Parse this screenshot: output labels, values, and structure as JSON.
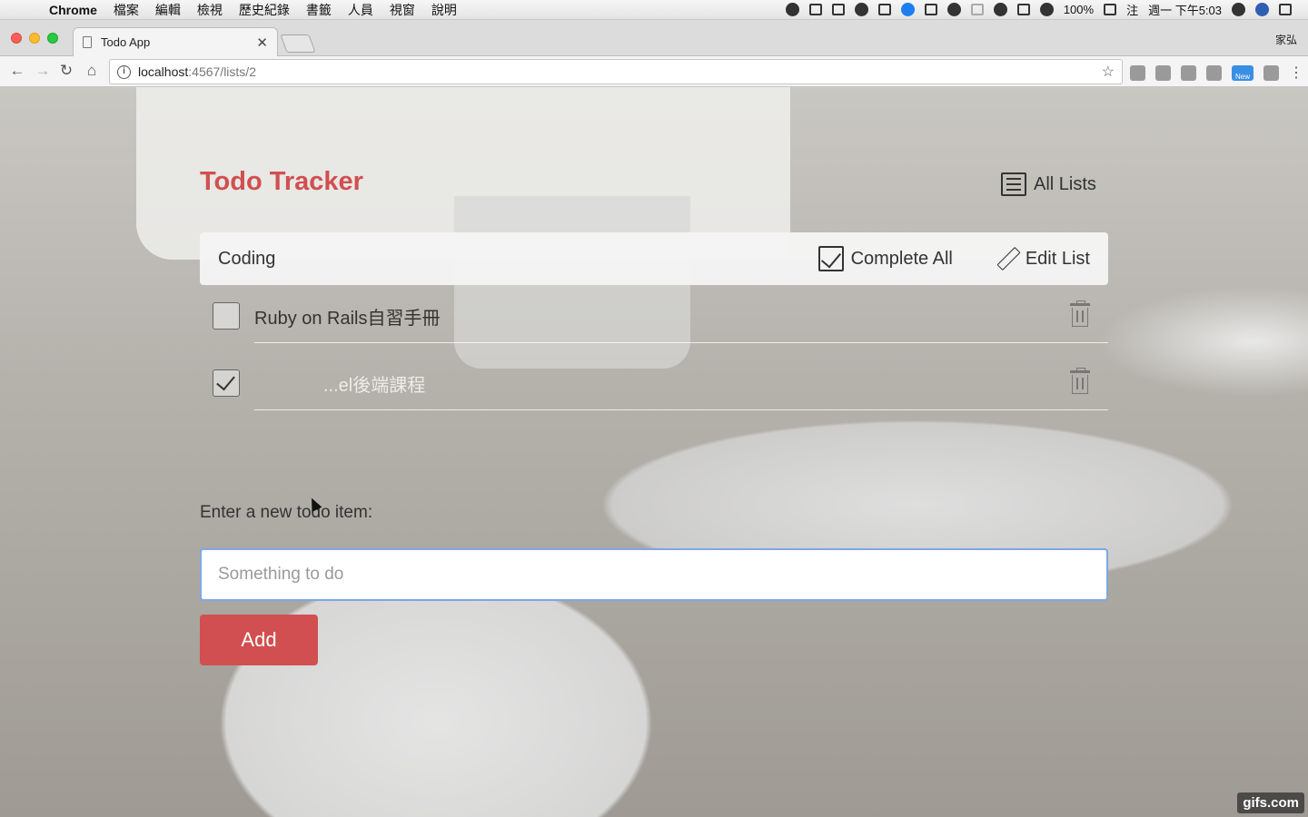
{
  "menubar": {
    "app_name": "Chrome",
    "menus": [
      "檔案",
      "編輯",
      "檢視",
      "歷史紀錄",
      "書籤",
      "人員",
      "視窗",
      "說明"
    ],
    "battery": "100%",
    "clock": "週一 下午5:03",
    "input_method": "注"
  },
  "browser": {
    "tab_title": "Todo App",
    "profile_name": "家弘",
    "url_host": "localhost",
    "url_path": ":4567/lists/2",
    "new_badge": "New"
  },
  "app": {
    "title": "Todo Tracker",
    "all_lists_label": "All Lists",
    "list": {
      "name": "Coding",
      "complete_all_label": "Complete All",
      "edit_list_label": "Edit List"
    },
    "todos": [
      {
        "text": "Ruby on Rails自習手冊",
        "completed": false
      },
      {
        "text": "...el後端課程",
        "completed": true
      }
    ],
    "new_todo": {
      "label": "Enter a new todo item:",
      "placeholder": "Something to do",
      "value": "",
      "submit_label": "Add"
    },
    "colors": {
      "accent": "#d14f50",
      "input_focus": "#7fa6e8"
    }
  },
  "watermark": "gifs.com"
}
